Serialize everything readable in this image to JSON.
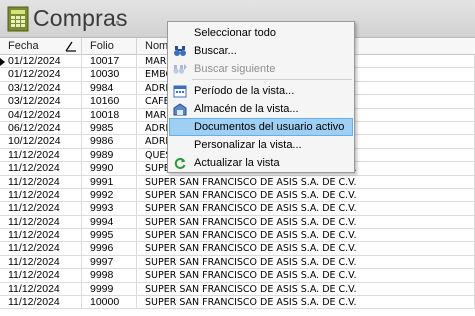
{
  "window": {
    "title": "Compras"
  },
  "columns": {
    "fecha": "Fecha",
    "folio": "Folio",
    "nombre": "Nombre"
  },
  "rows": [
    {
      "fecha": "01/12/2024",
      "folio": "10017",
      "nombre": "MARIA"
    },
    {
      "fecha": "01/12/2024",
      "folio": "10030",
      "nombre": "EMBOTI"
    },
    {
      "fecha": "03/12/2024",
      "folio": "9984",
      "nombre": "ADRIAN"
    },
    {
      "fecha": "03/12/2024",
      "folio": "10160",
      "nombre": "CAFE B"
    },
    {
      "fecha": "04/12/2024",
      "folio": "10018",
      "nombre": "MARIA"
    },
    {
      "fecha": "06/12/2024",
      "folio": "9985",
      "nombre": "ADRIAN"
    },
    {
      "fecha": "10/12/2024",
      "folio": "9986",
      "nombre": "ADRIAN"
    },
    {
      "fecha": "11/12/2024",
      "folio": "9989",
      "nombre": "QUESO"
    },
    {
      "fecha": "11/12/2024",
      "folio": "9990",
      "nombre": "SUPER SAN FRANCISCO DE ASIS S.A. DE C.V."
    },
    {
      "fecha": "11/12/2024",
      "folio": "9991",
      "nombre": "SUPER SAN FRANCISCO DE ASIS S.A. DE C.V."
    },
    {
      "fecha": "11/12/2024",
      "folio": "9992",
      "nombre": "SUPER SAN FRANCISCO DE ASIS S.A. DE C.V."
    },
    {
      "fecha": "11/12/2024",
      "folio": "9993",
      "nombre": "SUPER SAN FRANCISCO DE ASIS S.A. DE C.V."
    },
    {
      "fecha": "11/12/2024",
      "folio": "9994",
      "nombre": "SUPER SAN FRANCISCO DE ASIS S.A. DE C.V."
    },
    {
      "fecha": "11/12/2024",
      "folio": "9995",
      "nombre": "SUPER SAN FRANCISCO DE ASIS S.A. DE C.V."
    },
    {
      "fecha": "11/12/2024",
      "folio": "9996",
      "nombre": "SUPER SAN FRANCISCO DE ASIS S.A. DE C.V."
    },
    {
      "fecha": "11/12/2024",
      "folio": "9997",
      "nombre": "SUPER SAN FRANCISCO DE ASIS S.A. DE C.V."
    },
    {
      "fecha": "11/12/2024",
      "folio": "9998",
      "nombre": "SUPER SAN FRANCISCO DE ASIS S.A. DE C.V."
    },
    {
      "fecha": "11/12/2024",
      "folio": "9999",
      "nombre": "SUPER SAN FRANCISCO DE ASIS S.A. DE C.V."
    },
    {
      "fecha": "11/12/2024",
      "folio": "10000",
      "nombre": "SUPER SAN FRANCISCO DE ASIS S.A. DE C.V."
    }
  ],
  "context_menu": {
    "items": [
      {
        "label": "Seleccionar todo",
        "icon": "none",
        "enabled": true
      },
      {
        "label": "Buscar...",
        "icon": "binoculars-icon",
        "enabled": true
      },
      {
        "label": "Buscar siguiente",
        "icon": "binoculars-next-icon",
        "enabled": false
      },
      {
        "label": "Período de la vista...",
        "icon": "calendar-icon",
        "enabled": true
      },
      {
        "label": "Almacén de la vista...",
        "icon": "warehouse-icon",
        "enabled": true
      },
      {
        "label": "Documentos del usuario activo",
        "icon": "none",
        "enabled": true,
        "highlighted": true
      },
      {
        "label": "Personalizar la vista...",
        "icon": "none",
        "enabled": true
      },
      {
        "label": "Actualizar la vista",
        "icon": "refresh-icon",
        "enabled": true
      }
    ]
  },
  "colors": {
    "menu_highlight": "#9fd0f4",
    "disabled_text": "#8f8f8f"
  }
}
